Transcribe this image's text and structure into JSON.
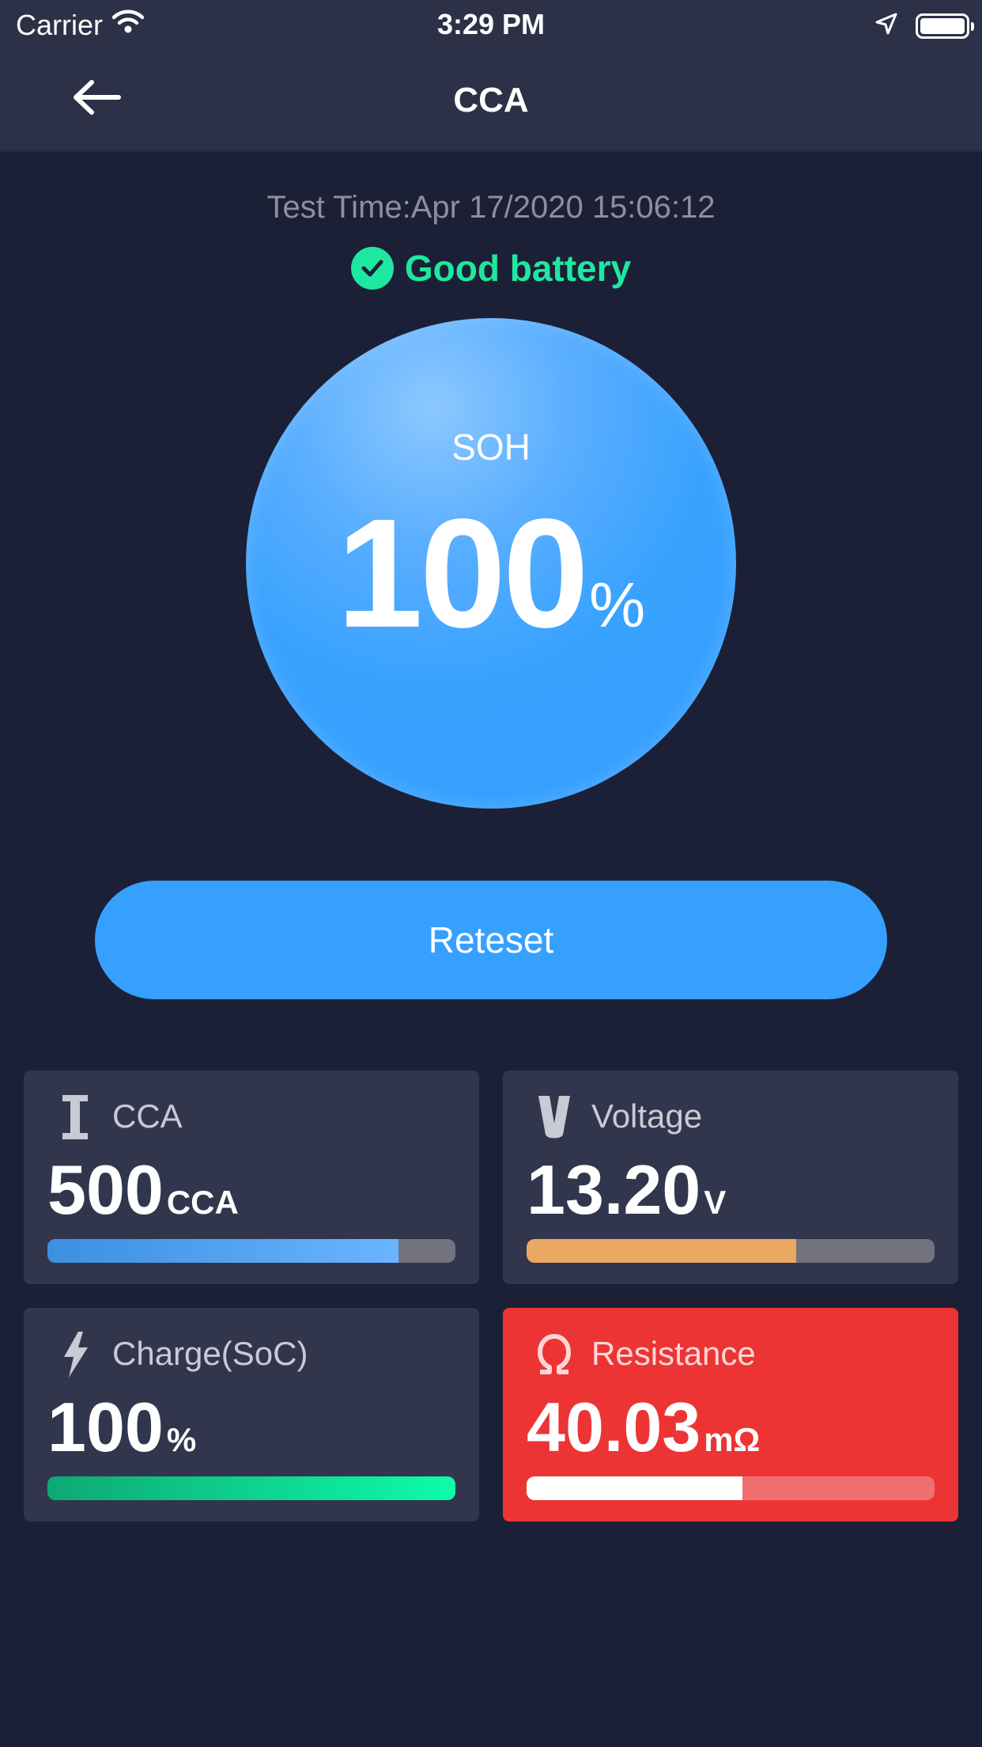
{
  "status_bar": {
    "carrier": "Carrier",
    "time": "3:29 PM"
  },
  "nav": {
    "title": "CCA"
  },
  "test_time": "Test Time:Apr 17/2020 15:06:12",
  "battery_status": "Good battery",
  "soh": {
    "label": "SOH",
    "value": "100",
    "unit": "%"
  },
  "retest_label": "Reteset",
  "cards": {
    "cca": {
      "label": "CCA",
      "value": "500",
      "unit": "CCA",
      "level": 0.86,
      "color_start": "#3b90e0",
      "color_end": "#6ab4ff"
    },
    "voltage": {
      "label": "Voltage",
      "value": "13.20",
      "unit": "V",
      "level": 0.66,
      "color_start": "#eaa863",
      "color_end": "#eaa863"
    },
    "charge": {
      "label": "Charge(SoC)",
      "value": "100",
      "unit": "%",
      "level": 1.0,
      "color_start": "#0ea874",
      "color_end": "#0dfcaa"
    },
    "resistance": {
      "label": "Resistance",
      "value": "40.03",
      "unit": "mΩ",
      "level": 0.53,
      "color_start": "#ffffff",
      "color_end": "#ffffff"
    }
  },
  "colors": {
    "background": "#1c2036",
    "header": "#2d3147",
    "accent": "#36a0ff",
    "good": "#1ee8a0",
    "alert": "#ec3434"
  }
}
